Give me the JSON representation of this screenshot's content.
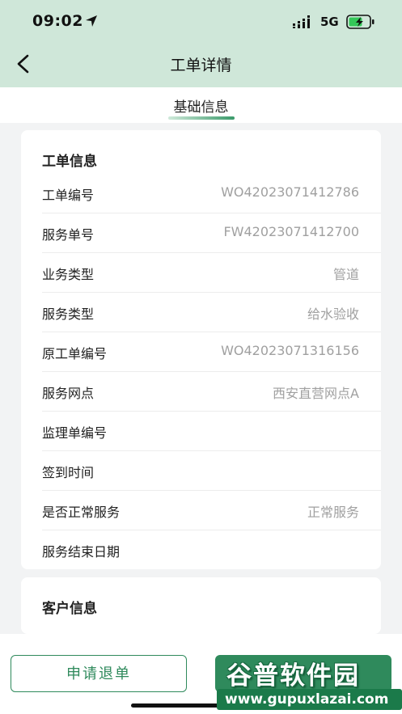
{
  "status_bar": {
    "time": "09:02",
    "network": "5G",
    "icons": [
      "location-arrow-icon",
      "signal-icon",
      "battery-charging-icon"
    ]
  },
  "nav": {
    "title": "工单详情",
    "back_icon": "chevron-left-icon"
  },
  "tabs": [
    {
      "label": "基础信息",
      "active": true
    }
  ],
  "work_order_card": {
    "title": "工单信息",
    "rows": [
      {
        "label": "工单编号",
        "value": "WO42023071412786"
      },
      {
        "label": "服务单号",
        "value": "FW42023071412700"
      },
      {
        "label": "业务类型",
        "value": "管道"
      },
      {
        "label": "服务类型",
        "value": "给水验收"
      },
      {
        "label": "原工单编号",
        "value": "WO42023071316156"
      },
      {
        "label": "服务网点",
        "value": "西安直营网点A"
      },
      {
        "label": "监理单编号",
        "value": ""
      },
      {
        "label": "签到时间",
        "value": ""
      },
      {
        "label": "是否正常服务",
        "value": "正常服务"
      },
      {
        "label": "服务结束日期",
        "value": ""
      }
    ]
  },
  "customer_card": {
    "title": "客户信息"
  },
  "actions": {
    "apply_cancel_label": "申请退单"
  },
  "watermark": {
    "text": "谷普软件园",
    "url": "www.gupuxlazai.com"
  },
  "colors": {
    "header_bg": "#cfe7d9",
    "accent_green": "#2f8a5c",
    "page_bg": "#f2f3f4",
    "value_gray": "#a0a0a0"
  }
}
